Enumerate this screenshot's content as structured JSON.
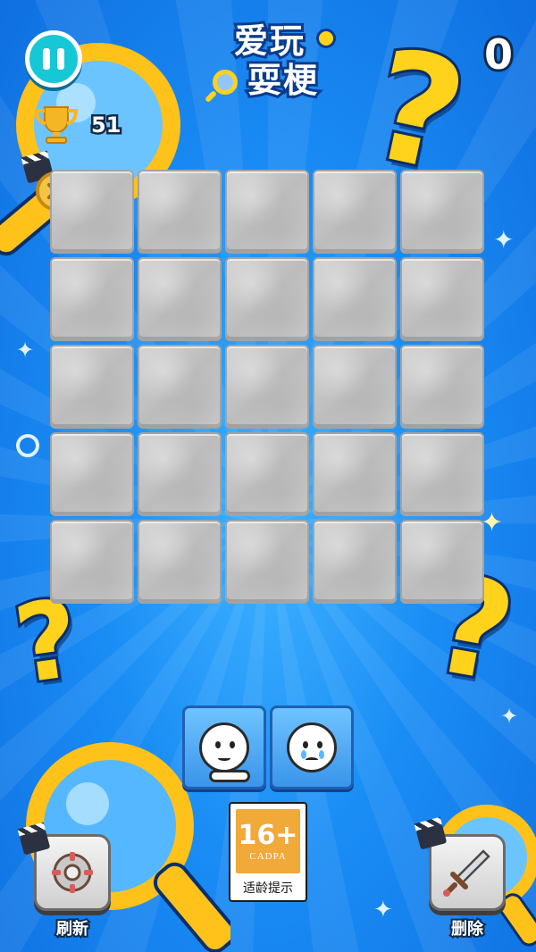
{
  "game": {
    "logo_line1": "爱玩",
    "logo_line2": "耍梗",
    "score_top_right": "0",
    "trophy_count": "51",
    "coin_count": "0"
  },
  "board": {
    "rows": 5,
    "cols": 5,
    "tiles_covered": 25
  },
  "tray": {
    "slots": [
      {
        "icon": "worried-face-crossed-arms-icon"
      },
      {
        "icon": "crying-face-icon"
      }
    ]
  },
  "rating": {
    "age": "16+",
    "org": "CADPA",
    "hint": "适龄提示"
  },
  "tools": {
    "refresh_label": "刷新",
    "delete_label": "删除"
  },
  "colors": {
    "background": "#1a8df5",
    "accent_yellow": "#ffd21c",
    "pause_teal": "#16c7d6",
    "rating_orange": "#f1a93a"
  }
}
